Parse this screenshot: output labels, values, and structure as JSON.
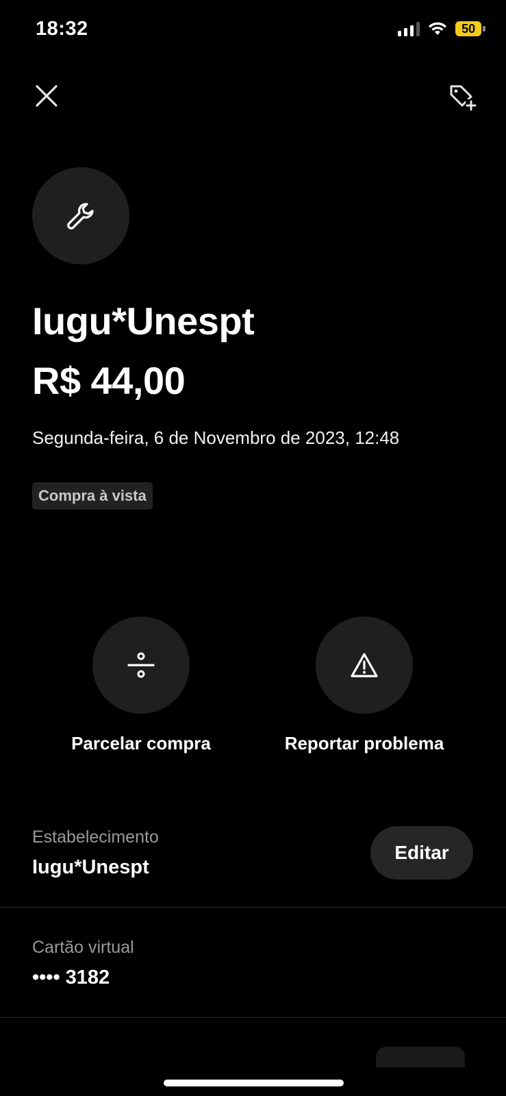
{
  "status_bar": {
    "time": "18:32",
    "battery_level": "50",
    "battery_color": "#f4cc1a"
  },
  "header": {
    "close_icon": "close-icon",
    "add_tag_icon": "tag-plus-icon"
  },
  "transaction": {
    "category_icon": "wrench-icon",
    "merchant": "Iugu*Unespt",
    "amount": "R$ 44,00",
    "datetime": "Segunda-feira, 6 de Novembro de 2023, 12:48",
    "payment_type": "Compra à vista"
  },
  "actions": [
    {
      "label": "Parcelar compra",
      "icon": "divide-icon"
    },
    {
      "label": "Reportar problema",
      "icon": "warning-icon"
    }
  ],
  "details": {
    "establishment": {
      "label": "Estabelecimento",
      "value": "Iugu*Unespt",
      "edit_label": "Editar"
    },
    "card": {
      "label": "Cartão virtual",
      "value": "•••• 3182"
    }
  },
  "colors": {
    "background": "#000000",
    "surface": "#1f1f1f",
    "accent_battery": "#f4cc1a"
  }
}
